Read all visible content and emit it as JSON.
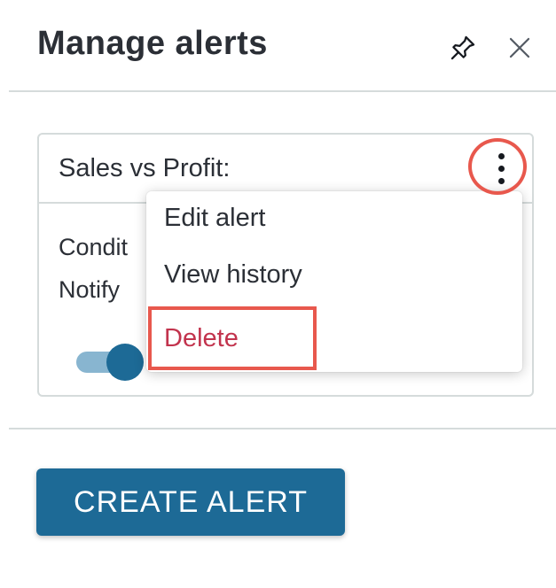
{
  "header": {
    "title": "Manage alerts",
    "pin_icon": "pin-icon",
    "close_icon": "close-icon"
  },
  "card": {
    "title": "Sales vs Profit:",
    "condition_label": "Condit",
    "notify_label": "Notify",
    "toggle_on": true
  },
  "menu": {
    "items": [
      {
        "label": "Edit alert"
      },
      {
        "label": "View history"
      },
      {
        "label": "Delete"
      }
    ]
  },
  "footer": {
    "create_label": "CREATE ALERT"
  },
  "colors": {
    "accent": "#1d6a96",
    "danger": "#c2334d",
    "highlight": "#e8584d",
    "border": "#d5dbdb"
  }
}
